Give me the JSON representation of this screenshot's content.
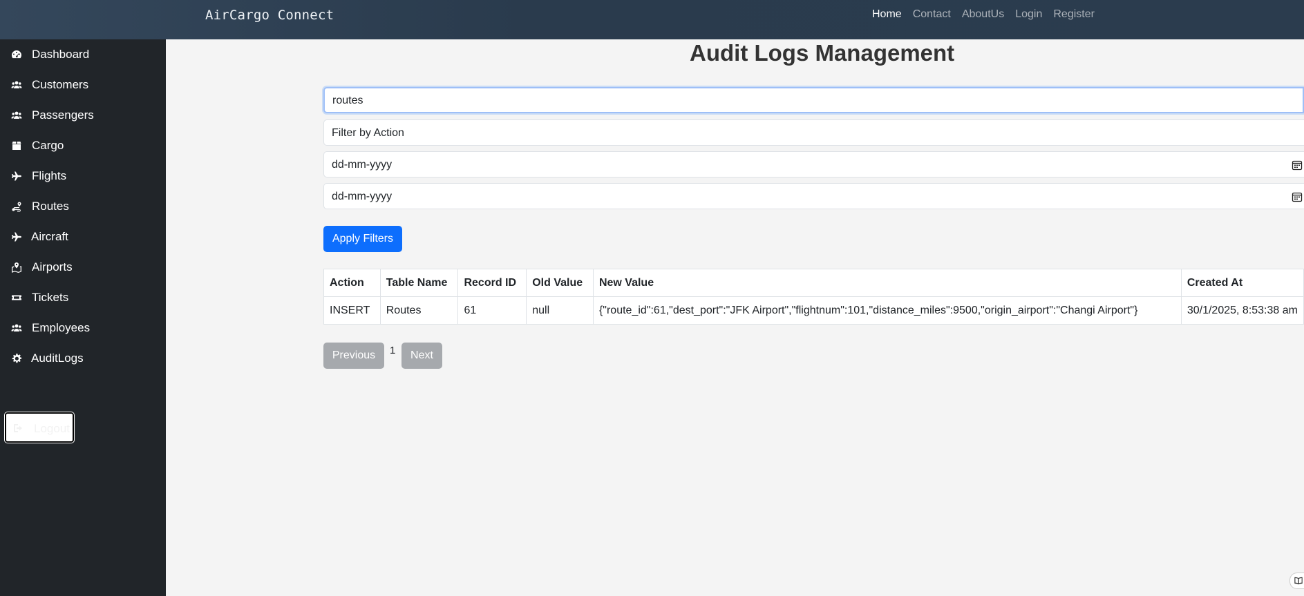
{
  "brand": "AirCargo Connect",
  "nav": [
    "Home",
    "Contact",
    "AboutUs",
    "Login",
    "Register"
  ],
  "sidebar": {
    "items": [
      {
        "label": "Dashboard",
        "icon": "gauge-icon"
      },
      {
        "label": "Customers",
        "icon": "users-icon"
      },
      {
        "label": "Passengers",
        "icon": "users-icon"
      },
      {
        "label": "Cargo",
        "icon": "box-icon"
      },
      {
        "label": "Flights",
        "icon": "plane-icon"
      },
      {
        "label": "Routes",
        "icon": "route-icon"
      },
      {
        "label": "Aircraft",
        "icon": "plane-icon"
      },
      {
        "label": "Airports",
        "icon": "map-icon"
      },
      {
        "label": "Tickets",
        "icon": "ticket-icon"
      },
      {
        "label": "Employees",
        "icon": "users-icon"
      },
      {
        "label": "AuditLogs",
        "icon": "gear-icon"
      }
    ],
    "logout": "Logout"
  },
  "main": {
    "title": "Audit Logs Management",
    "search_value": "routes",
    "action_filter": "Filter by Action",
    "start_date_placeholder": "dd-mm-yyyy",
    "end_date_placeholder": "dd-mm-yyyy",
    "apply_label": "Apply Filters"
  },
  "table": {
    "headers": [
      "Action",
      "Table Name",
      "Record ID",
      "Old Value",
      "New Value",
      "Created At"
    ],
    "rows": [
      [
        "INSERT",
        "Routes",
        "61",
        "null",
        "{\"route_id\":61,\"dest_port\":\"JFK Airport\",\"flightnum\":101,\"distance_miles\":9500,\"origin_airport\":\"Changi Airport\"}",
        "30/1/2025, 8:53:38 am"
      ]
    ]
  },
  "pagination": {
    "previous": "Previous",
    "page": "1",
    "next": "Next"
  },
  "colors": {
    "topbar": "#2c3e50",
    "sidebar": "#212529",
    "primary": "#0d6efd",
    "disabled": "#a6a9ad"
  }
}
